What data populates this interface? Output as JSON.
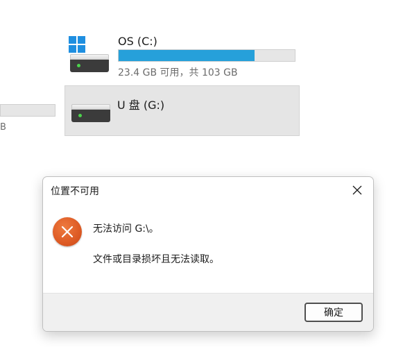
{
  "explorer": {
    "left_partial_drive": {
      "space_text_fragment": "B"
    },
    "drives": [
      {
        "name": "OS (C:)",
        "icon": "windows-hdd-icon",
        "space_text": "23.4 GB 可用，共 103 GB",
        "used_fraction": 0.77
      },
      {
        "name": "U 盘 (G:)",
        "icon": "hdd-icon",
        "selected": true
      }
    ]
  },
  "dialog": {
    "title": "位置不可用",
    "close_icon": "close-icon",
    "icon": "error-icon",
    "message_line1": "无法访问 G:\\。",
    "message_line2": "文件或目录损坏且无法读取。",
    "ok_label": "确定"
  },
  "colors": {
    "usage_bar_fill": "#26a0da",
    "selection_background": "#e5e5e5",
    "error_icon": "#dd5a24",
    "windows_logo": "#1f8fe0",
    "drive_led": "#4cd44c"
  }
}
